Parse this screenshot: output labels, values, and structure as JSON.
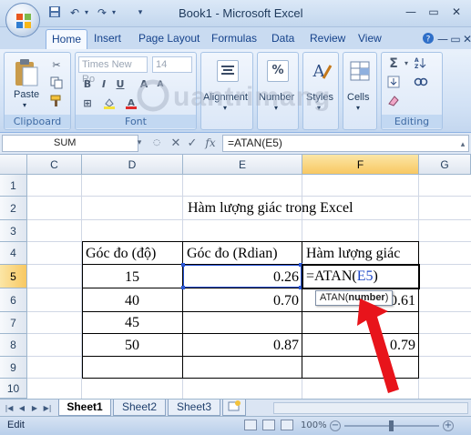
{
  "window": {
    "title": "Book1 - Microsoft Excel"
  },
  "ribbon": {
    "tabs": [
      "Home",
      "Insert",
      "Page Layout",
      "Formulas",
      "Data",
      "Review",
      "View"
    ],
    "clipboard": {
      "paste_label": "Paste",
      "group_label": "Clipboard"
    },
    "font": {
      "font_name": "Times New Ro",
      "font_size": "14",
      "group_label": "Font"
    },
    "alignment_label": "Alignment",
    "number_label": "Number",
    "styles_label": "Styles",
    "cells_label": "Cells",
    "editing_label": "Editing",
    "number_icon": "%"
  },
  "formula_bar": {
    "name_box": "SUM",
    "fx": "fx",
    "formula": "=ATAN(E5)"
  },
  "grid": {
    "columns": [
      "C",
      "D",
      "E",
      "F",
      "G"
    ],
    "rows": [
      "1",
      "2",
      "3",
      "4",
      "5",
      "6",
      "7",
      "8",
      "9",
      "10"
    ],
    "title_cell": "Hàm lượng giác trong Excel",
    "headers": [
      "Góc đo (độ)",
      "Góc đo (Rdian)",
      "Hàm lượng giác"
    ],
    "d_values": [
      "15",
      "40",
      "45",
      "50"
    ],
    "e_values": [
      "0.26",
      "0.70",
      "",
      "0.87"
    ],
    "f_values": [
      "=ATAN(E5)",
      "0.61",
      "",
      "0.79"
    ],
    "f5_prefix": "=ATAN(",
    "f5_ref": "E5",
    "f5_suffix": ")",
    "tooltip_fn": "ATAN(",
    "tooltip_arg": "number",
    "tooltip_close": ")"
  },
  "sheets": [
    "Sheet1",
    "Sheet2",
    "Sheet3"
  ],
  "status": {
    "mode": "Edit",
    "zoom": "100%"
  },
  "watermark": "Quantrimang",
  "colors": {
    "ribbon_bg": "#d1e1f5",
    "selected_header": "#f8c862",
    "reference_blue": "#1f49c8",
    "arrow_red": "#e8141b"
  }
}
